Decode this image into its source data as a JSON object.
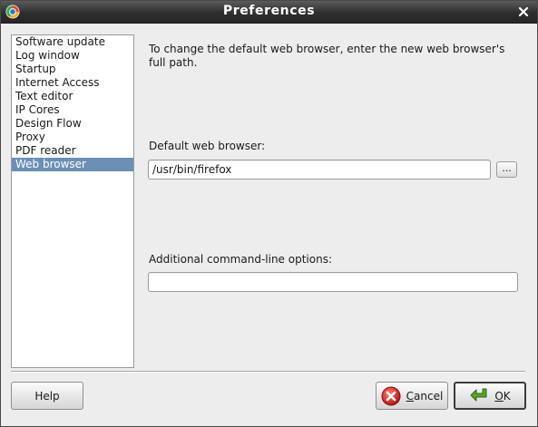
{
  "window": {
    "title": "Preferences",
    "icon": "app-logo-icon",
    "close_icon": "close-icon"
  },
  "sidebar": {
    "items": [
      {
        "label": "Software update",
        "selected": false
      },
      {
        "label": "Log window",
        "selected": false
      },
      {
        "label": "Startup",
        "selected": false
      },
      {
        "label": "Internet Access",
        "selected": false
      },
      {
        "label": "Text editor",
        "selected": false
      },
      {
        "label": "IP Cores",
        "selected": false
      },
      {
        "label": "Design Flow",
        "selected": false
      },
      {
        "label": "Proxy",
        "selected": false
      },
      {
        "label": "PDF reader",
        "selected": false
      },
      {
        "label": "Web browser",
        "selected": true
      }
    ],
    "selected_color": "#6c8fb5"
  },
  "main": {
    "description": "To change the default web browser, enter the new web browser's full path.",
    "browser_label": "Default web browser:",
    "browser_value": "/usr/bin/firefox",
    "browse_label": "...",
    "options_label": "Additional command-line options:",
    "options_value": ""
  },
  "footer": {
    "help_label": "Help",
    "cancel_mnemonic": "C",
    "cancel_rest": "ancel",
    "cancel_icon": "cancel-icon",
    "ok_mnemonic": "O",
    "ok_rest": "K",
    "ok_icon": "ok-arrow-icon"
  }
}
